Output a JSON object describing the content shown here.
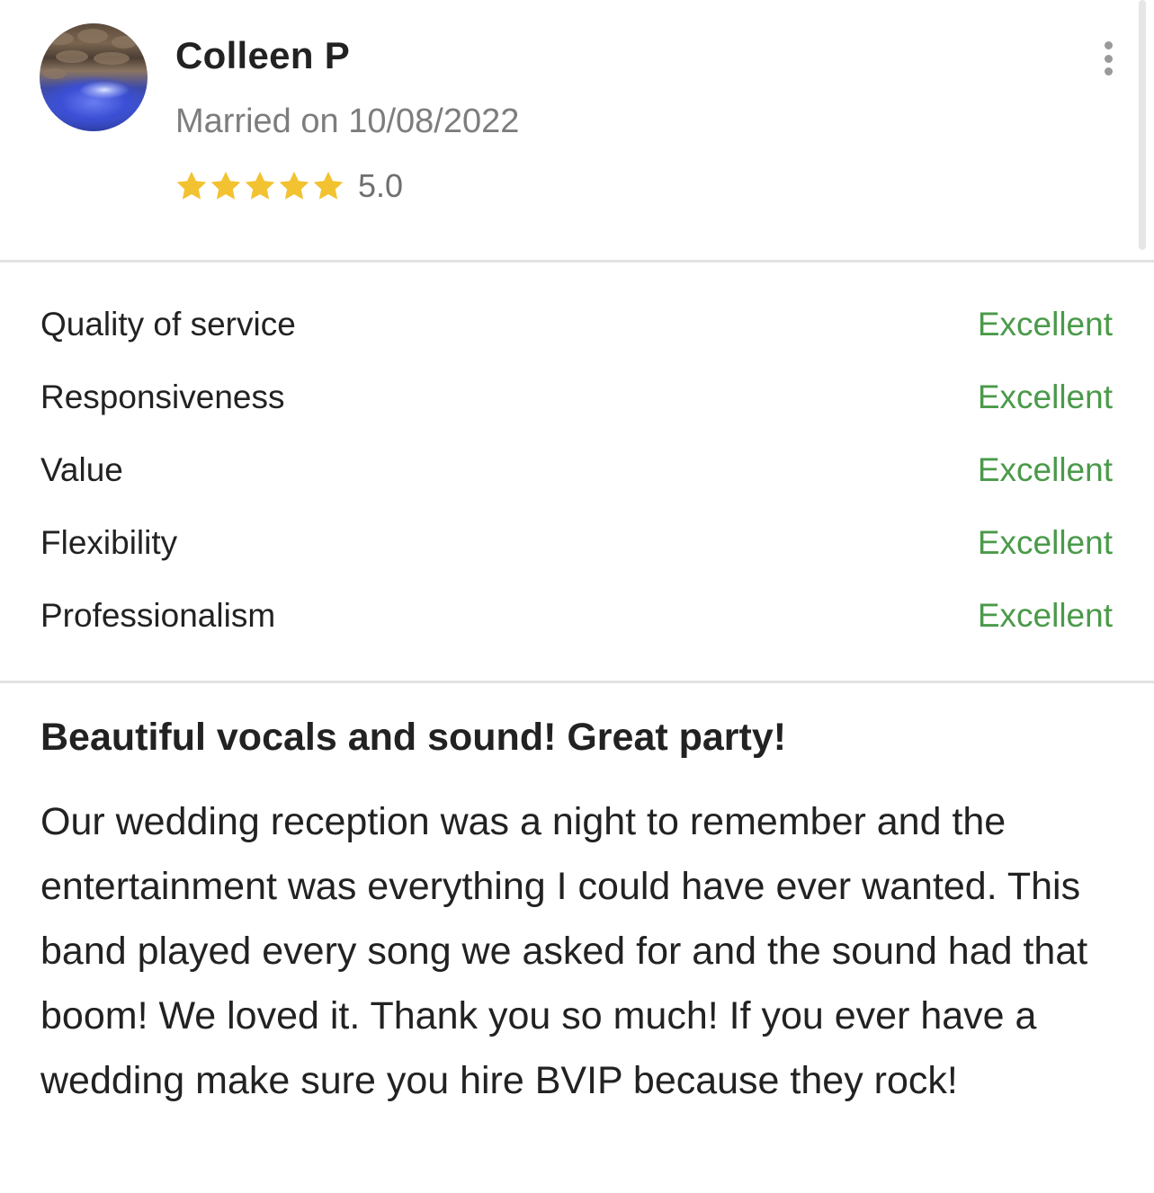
{
  "reviewer": {
    "name": "Colleen P",
    "married_on": "Married on 10/08/2022",
    "rating": {
      "value_label": "5.0",
      "stars_filled": 5,
      "stars_total": 5
    },
    "avatar_icon": "avatar-photo"
  },
  "menu": {
    "icon": "more-vertical-icon"
  },
  "ratings": [
    {
      "label": "Quality of service",
      "score": "Excellent"
    },
    {
      "label": "Responsiveness",
      "score": "Excellent"
    },
    {
      "label": "Value",
      "score": "Excellent"
    },
    {
      "label": "Flexibility",
      "score": "Excellent"
    },
    {
      "label": "Professionalism",
      "score": "Excellent"
    }
  ],
  "review": {
    "title": "Beautiful vocals and sound! Great party!",
    "text": "Our wedding reception was a night to remember and the entertainment was everything I could have ever wanted. This band played every song we asked for and the sound had that boom! We loved it. Thank you so much! If you ever have a wedding make sure you hire BVIP because they rock!"
  },
  "colors": {
    "star": "#f2c230",
    "score_text": "#4a9a4a",
    "secondary_text": "#7d7d7d",
    "divider": "#e3e3e3"
  }
}
